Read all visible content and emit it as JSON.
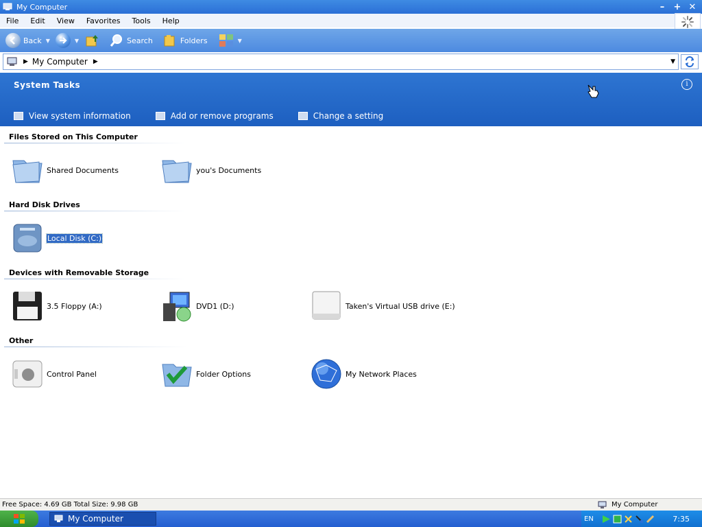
{
  "window": {
    "title": "My Computer"
  },
  "menu": [
    "File",
    "Edit",
    "View",
    "Favorites",
    "Tools",
    "Help"
  ],
  "toolbar": {
    "back": "Back",
    "search": "Search",
    "folders": "Folders"
  },
  "address": {
    "value": "My Computer"
  },
  "tasks": {
    "title": "System Tasks",
    "items": [
      "View system information",
      "Add or remove programs",
      "Change a setting"
    ]
  },
  "groups": [
    {
      "title": "Files Stored on This Computer",
      "items": [
        "Shared Documents",
        "you's Documents"
      ]
    },
    {
      "title": "Hard Disk Drives",
      "items": [
        "Local Disk (C:)"
      ]
    },
    {
      "title": "Devices with Removable Storage",
      "items": [
        "3.5 Floppy (A:)",
        "DVD1 (D:)",
        "Taken's Virtual USB drive (E:)"
      ]
    },
    {
      "title": "Other",
      "items": [
        "Control Panel",
        "Folder Options",
        "My Network Places"
      ]
    }
  ],
  "status": {
    "left": "Free Space: 4.69 GB Total Size: 9.98 GB",
    "right": "My Computer"
  },
  "taskbar": {
    "task": "My Computer",
    "lang": "EN",
    "clock": "7:35"
  },
  "colors": {
    "accent": "#2e75d2",
    "selection": "#316ac5",
    "start": "#3ea23a"
  }
}
